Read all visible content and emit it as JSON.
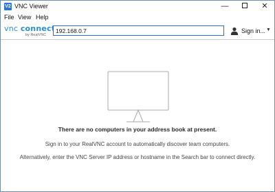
{
  "window": {
    "title": "VNC Viewer",
    "app_icon_text": "V2"
  },
  "menu": {
    "file": "File",
    "view": "View",
    "help": "Help"
  },
  "toolbar": {
    "logo_main_thin": "vnc ",
    "logo_main_bold": "connect",
    "logo_sub": "by RealVNC",
    "search_value": "192.168.0.7",
    "signin_label": "Sign in..."
  },
  "main": {
    "empty_title": "There are no computers in your address book at present.",
    "line1": "Sign in to your RealVNC account to automatically discover team computers.",
    "line2": "Alternatively, enter the VNC Server IP address or hostname in the Search bar to connect directly."
  },
  "colors": {
    "accent": "#2a8bd8",
    "focus_border": "#2a6ec7"
  }
}
